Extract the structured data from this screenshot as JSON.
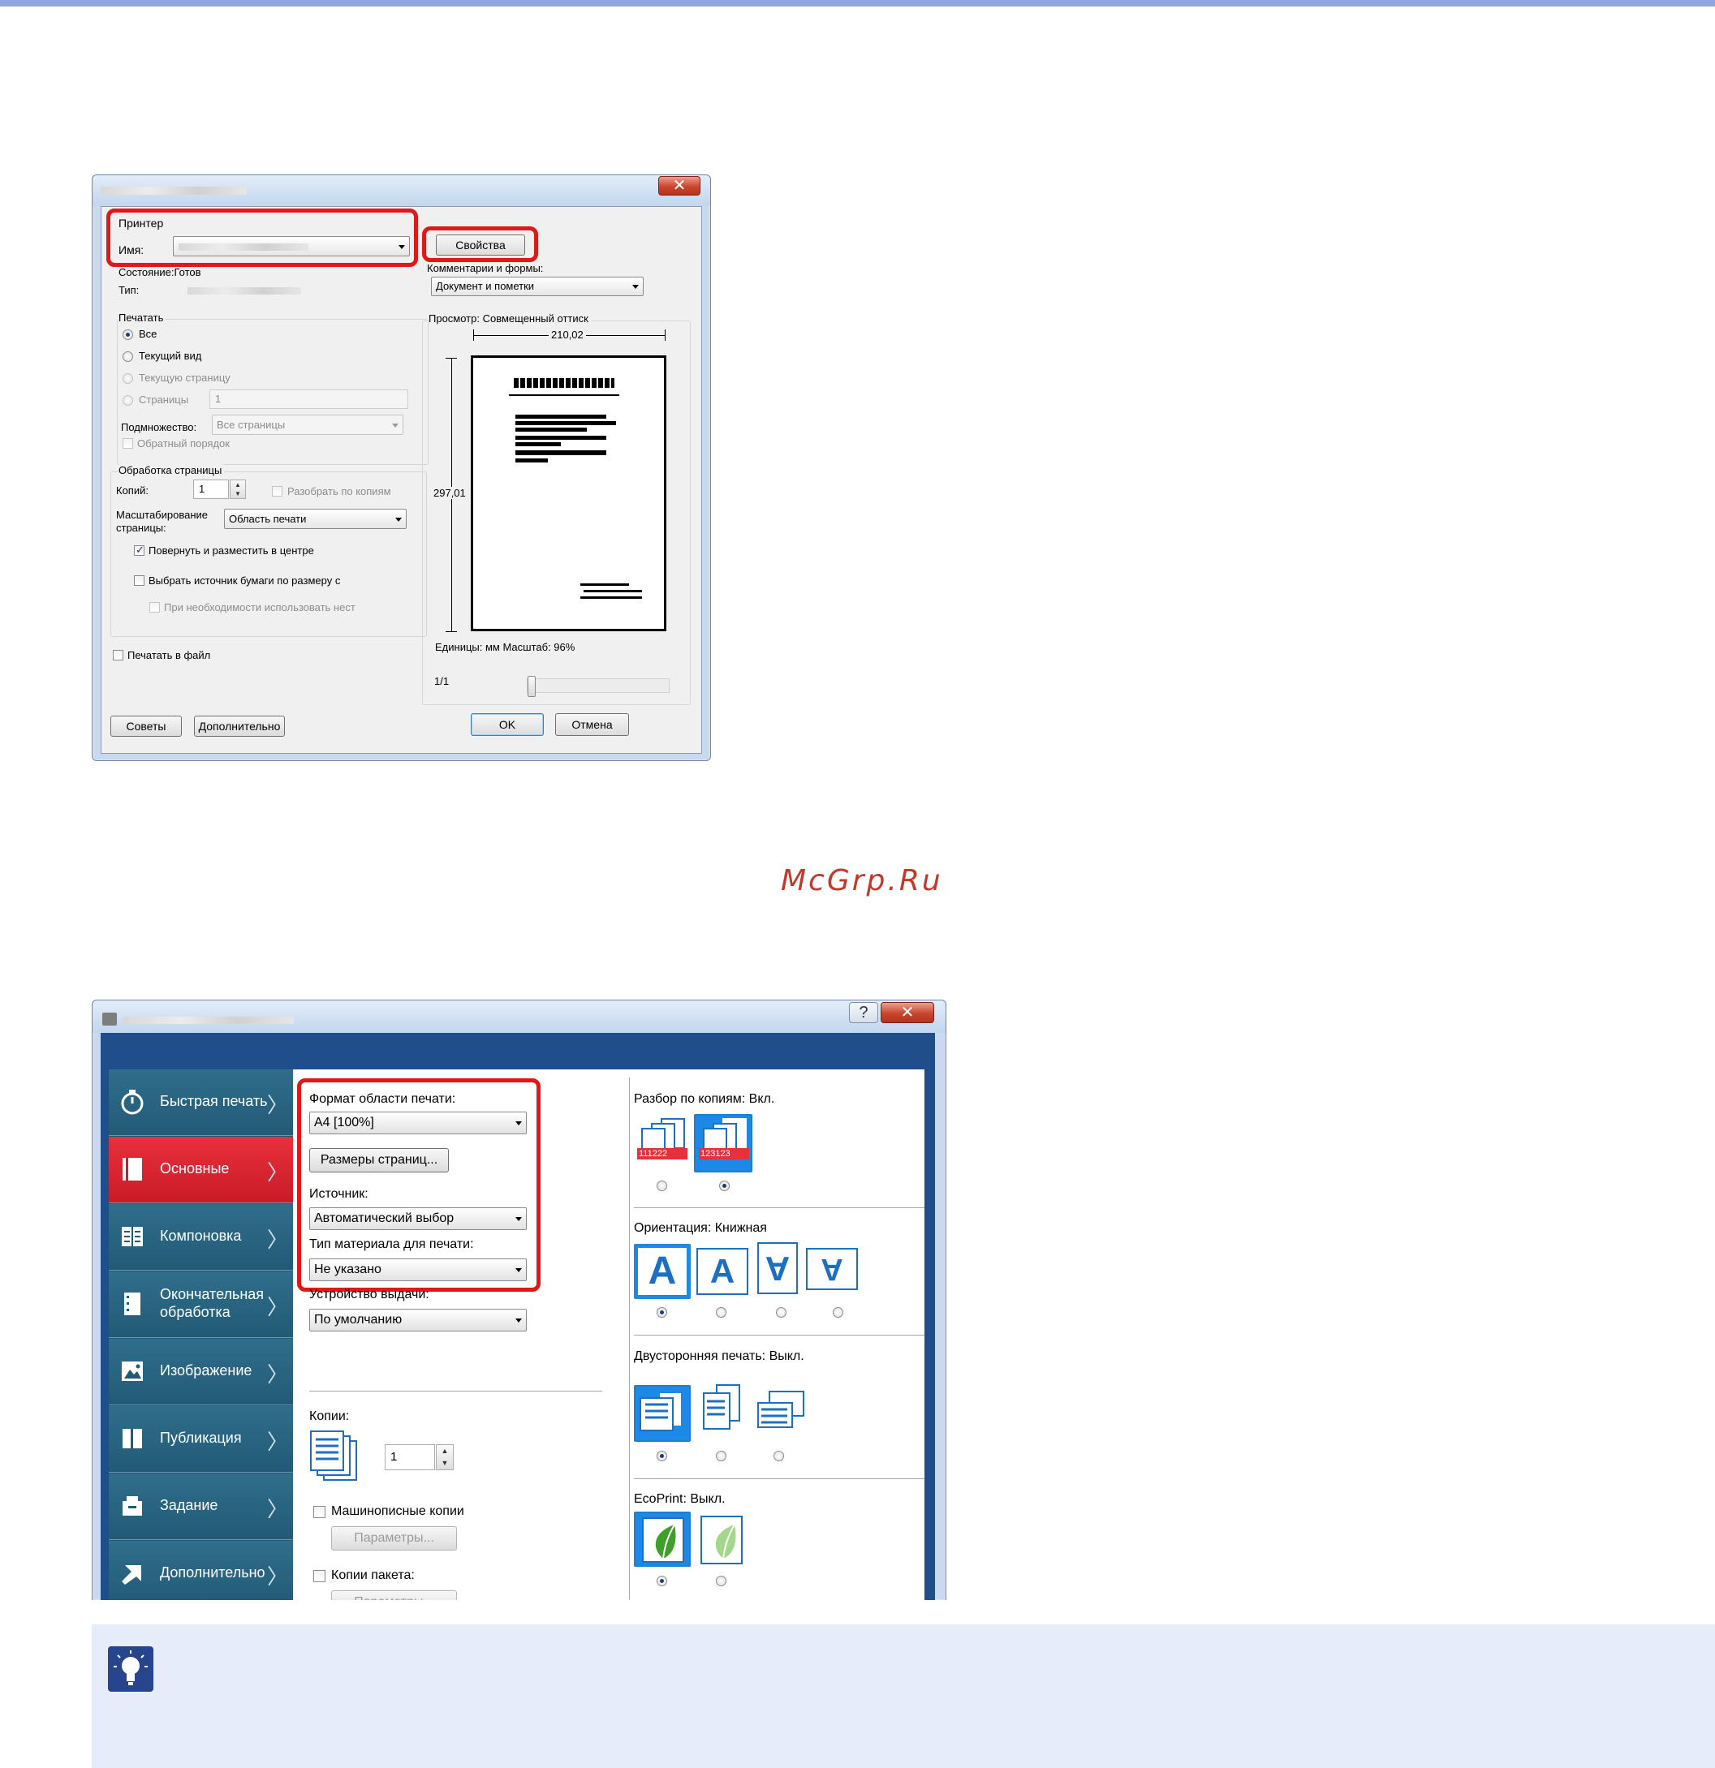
{
  "print_dialog": {
    "printer_group": "Принтер",
    "name_label": "Имя:",
    "properties_button": "Свойства",
    "status": "Состояние:Готов",
    "type_label": "Тип:",
    "comments_label": "Комментарии и формы:",
    "comments_value": "Документ и пометки",
    "print_range_group": "Печатать",
    "range_all": "Все",
    "range_current_view": "Текущий вид",
    "range_current_page": "Текущую страницу",
    "range_pages": "Страницы",
    "pages_value": "1",
    "subset_label": "Подмножество:",
    "subset_value": "Все страницы",
    "reverse_order": "Обратный порядок",
    "page_handling_group": "Обработка страницы",
    "copies_label": "Копий:",
    "copies_value": "1",
    "collate": "Разобрать по копиям",
    "scaling_label_1": "Масштабирование",
    "scaling_label_2": "страницы:",
    "scaling_value": "Область печати",
    "rotate_center": "Повернуть и разместить в центре",
    "choose_source": "Выбрать источник бумаги по размеру с",
    "use_custom": "При необходимости использовать нест",
    "print_to_file": "Печатать в файл",
    "preview_label": "Просмотр: Совмещенный оттиск",
    "width_value": "210,02",
    "height_value": "297,01",
    "units_scale": "Единицы: мм Масштаб:  96%",
    "page_count": "1/1",
    "tips_button": "Советы",
    "advanced_button": "Дополнительно",
    "ok_button": "OK",
    "cancel_button": "Отмена"
  },
  "watermark": "McGrp.Ru",
  "properties_dialog": {
    "nav": [
      {
        "label": "Быстрая печать",
        "icon": "stopwatch-icon"
      },
      {
        "label": "Основные",
        "icon": "page-icon"
      },
      {
        "label": "Компоновка",
        "icon": "layout-icon"
      },
      {
        "label": "Окончательная обработка",
        "icon": "finishing-icon"
      },
      {
        "label": "Изображение",
        "icon": "image-icon"
      },
      {
        "label": "Публикация",
        "icon": "publishing-icon"
      },
      {
        "label": "Задание",
        "icon": "job-icon"
      },
      {
        "label": "Дополнительно",
        "icon": "arrow-icon"
      }
    ],
    "print_size_label": "Формат области печати:",
    "print_size_value": "A4  [100%]",
    "page_sizes_button": "Размеры страниц...",
    "source_label": "Источник:",
    "source_value": "Автоматический выбор",
    "media_label": "Тип материала для печати:",
    "media_value": "Не указано",
    "output_label": "Устройство выдачи:",
    "output_value": "По умолчанию",
    "copies_label": "Копии:",
    "copies_value": "1",
    "typed_copies": "Машинописные копии",
    "params_button_1": "Параметры...",
    "batch_copies": "Копии пакета:",
    "params_button_2": "Параметры...",
    "collate_label": "Разбор по копиям:",
    "collate_value": "Вкл.",
    "collate_icon_1_text": "111222",
    "collate_icon_2_text": "123123",
    "orientation_label": "Ориентация:",
    "orientation_value": "Книжная",
    "orientation_glyph": "A",
    "duplex_label": "Двусторонняя печать:",
    "duplex_value": "Выкл.",
    "ecoprint_label": "EcoPrint:",
    "ecoprint_value": "Выкл."
  }
}
